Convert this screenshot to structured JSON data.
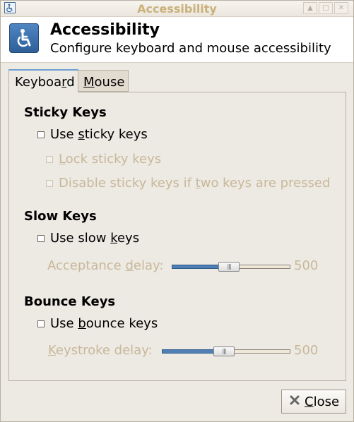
{
  "window": {
    "title": "Accessibility"
  },
  "header": {
    "title": "Accessibility",
    "subtitle": "Configure keyboard and mouse accessibility"
  },
  "tabs": [
    {
      "pre": "Keyboa",
      "mn": "r",
      "post": "d",
      "selected": true
    },
    {
      "pre": "",
      "mn": "M",
      "post": "ouse",
      "selected": false
    }
  ],
  "sticky": {
    "heading": "Sticky Keys",
    "use": {
      "pre": "Use ",
      "mn": "s",
      "post": "ticky keys",
      "checked": false
    },
    "lock": {
      "pre": "",
      "mn": "L",
      "post": "ock sticky keys",
      "checked": false
    },
    "disable": {
      "pre": "Disable sticky keys if ",
      "mn": "t",
      "post": "wo keys are pressed",
      "checked": false
    }
  },
  "slow": {
    "heading": "Slow Keys",
    "use": {
      "pre": "Use slow ",
      "mn": "k",
      "post": "eys",
      "checked": false
    },
    "delay": {
      "pre": "Acceptance ",
      "mn": "d",
      "post": "elay:",
      "value": "500",
      "fraction": 0.48
    }
  },
  "bounce": {
    "heading": "Bounce Keys",
    "use": {
      "pre": "Use ",
      "mn": "b",
      "post": "ounce keys",
      "checked": false
    },
    "delay": {
      "pre": "",
      "mn": "K",
      "post": "eystroke delay:",
      "value": "500",
      "fraction": 0.48
    }
  },
  "footer": {
    "close": {
      "pre": "",
      "mn": "C",
      "post": "lose"
    }
  },
  "icons": {
    "title": "accessibility-icon",
    "header": "accessibility-wheelchair-icon",
    "close": "close-x-icon",
    "titlebar_buttons": [
      "shade-icon",
      "maximize-icon",
      "close-window-icon"
    ]
  },
  "colors": {
    "accent": "#4f7fb5",
    "disabled_text": "#c8b89a",
    "tab_highlight": "#6fa0d6"
  }
}
